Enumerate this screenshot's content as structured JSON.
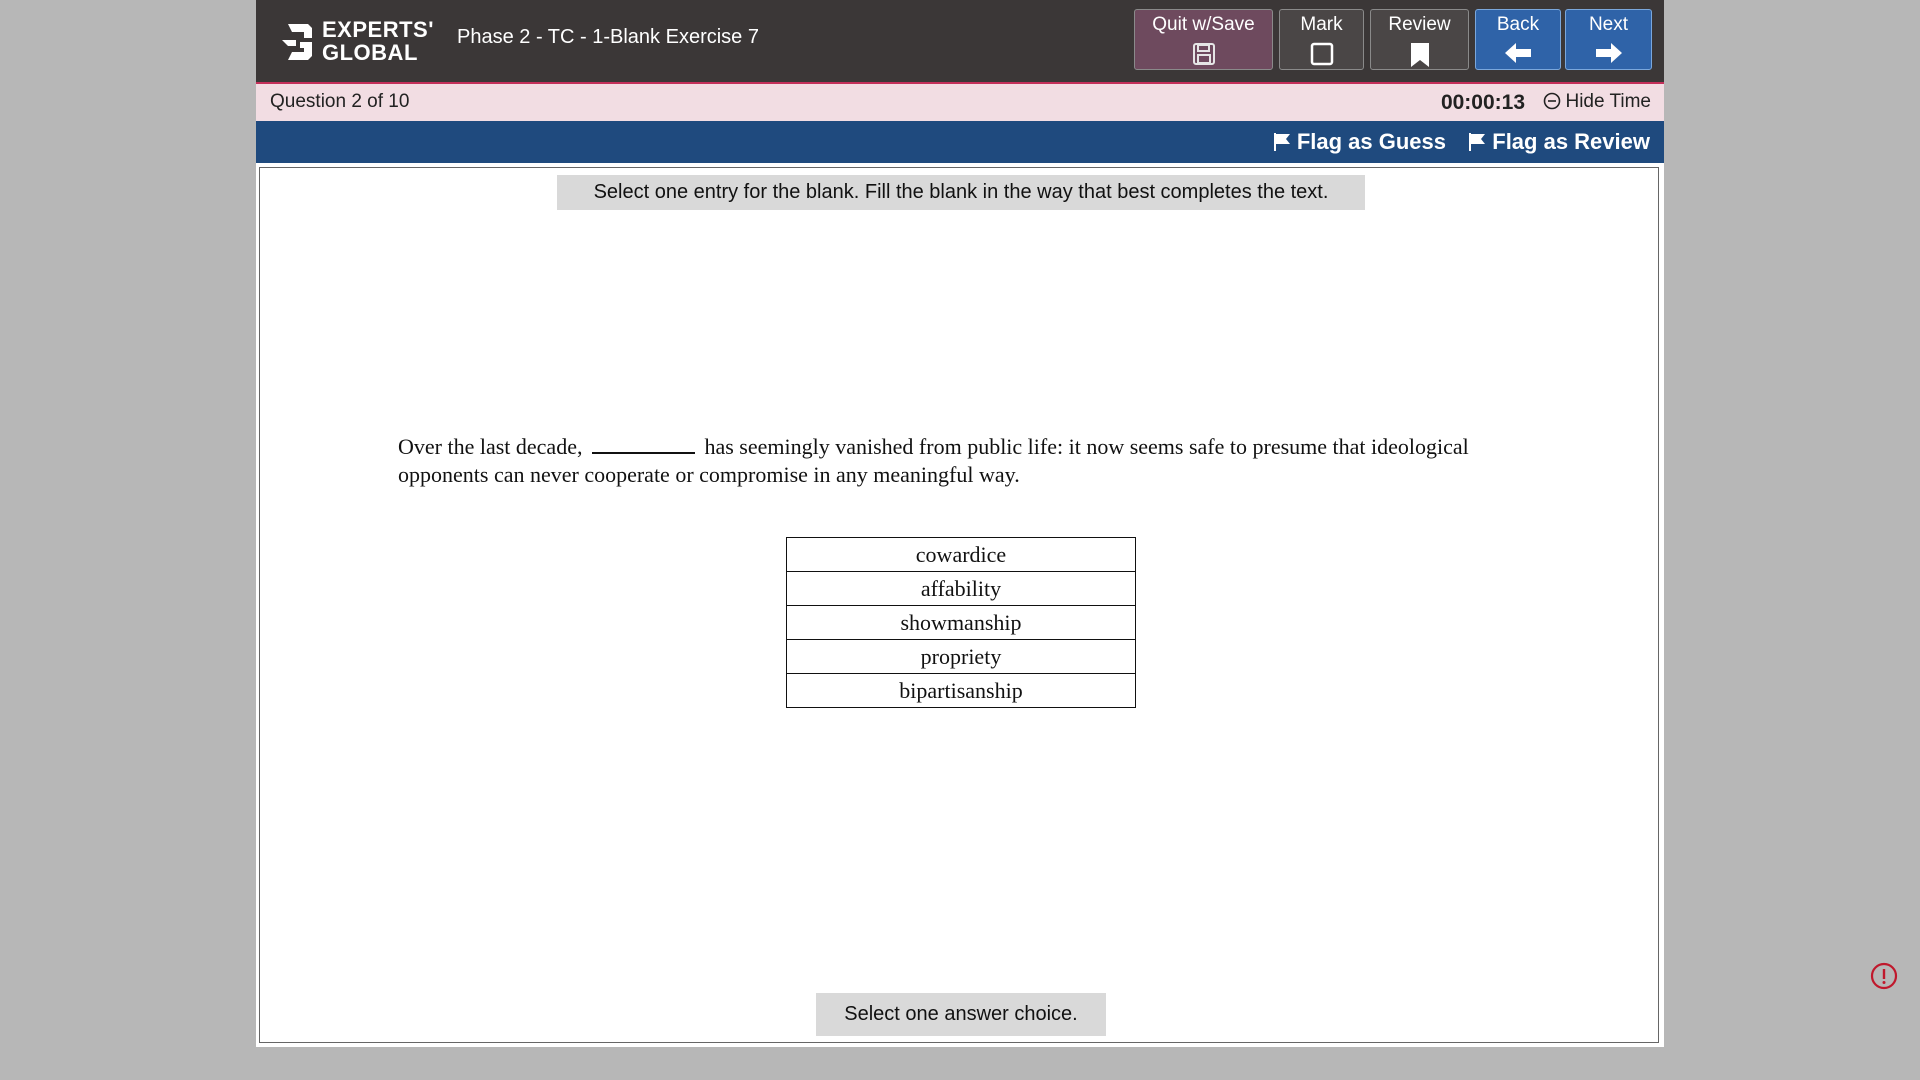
{
  "header": {
    "logo_text_1": "EXPERTS'",
    "logo_text_2": "GLOBAL",
    "exercise_title": "Phase 2 - TC - 1-Blank Exercise 7",
    "buttons": {
      "quit": "Quit w/Save",
      "mark": "Mark",
      "review": "Review",
      "back": "Back",
      "next": "Next"
    }
  },
  "question_bar": {
    "count": "Question 2 of 10",
    "timer": "00:00:13",
    "hide_time": "Hide Time"
  },
  "flag_bar": {
    "flag_guess": "Flag as Guess",
    "flag_review": "Flag as Review"
  },
  "content": {
    "instruction": "Select one entry for the blank. Fill the blank in the way that best completes the text.",
    "passage_before": "Over the last decade,",
    "passage_after": "has seemingly vanished from public life: it now seems safe to presume that ideological opponents can never cooperate or compromise in any meaningful way.",
    "choices": [
      "cowardice",
      "affability",
      "showmanship",
      "propriety",
      "bipartisanship"
    ],
    "answer_note": "Select one answer choice."
  },
  "colors": {
    "header_bg": "#3b3737",
    "question_bar_bg": "#f2dde3",
    "flag_bar_bg": "#1f4a7e",
    "nav_button_bg": "#2f63a8",
    "quit_button_bg": "#6e4a5e",
    "alert": "#c0182c"
  },
  "icons": {
    "quit": "save-icon",
    "mark": "checkbox-icon",
    "review": "bookmark-icon",
    "back": "arrow-left-icon",
    "next": "arrow-right-icon",
    "hide_time": "minus-circle-icon",
    "flag": "flag-icon",
    "alert": "alert-circle-icon"
  }
}
